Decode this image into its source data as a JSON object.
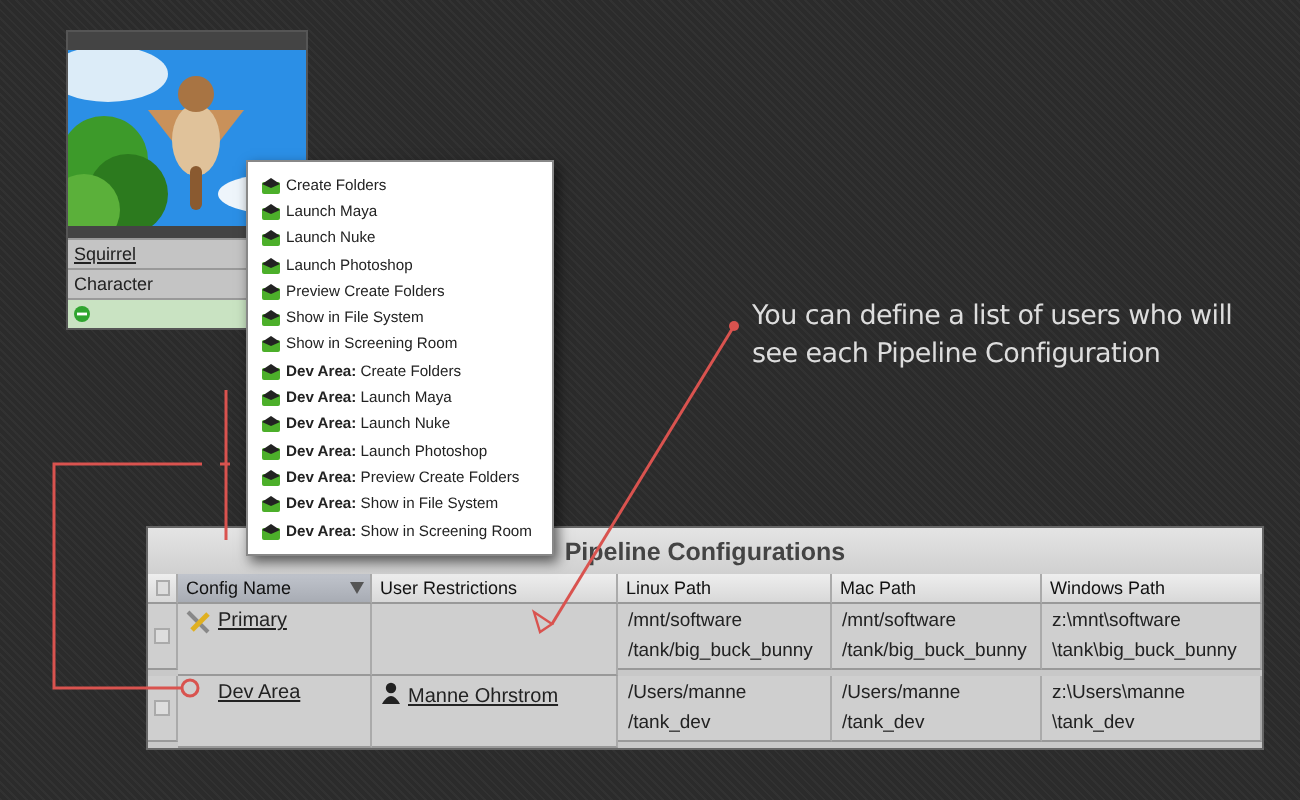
{
  "entity_card": {
    "kind": "picture",
    "name": "Squirrel",
    "type": "Character"
  },
  "context_menu": {
    "items": [
      {
        "label": "Create Folders"
      },
      {
        "label": "Launch Maya"
      },
      {
        "label": "Launch Nuke"
      },
      {
        "label": "Launch Photoshop"
      },
      {
        "label": "Preview Create Folders"
      },
      {
        "label": "Show in File System"
      },
      {
        "label": "Show in Screening Room"
      },
      {
        "label": "**Dev Area:** Create Folders"
      },
      {
        "label": "**Dev Area:** Launch Maya"
      },
      {
        "label": "**Dev Area:** Launch Nuke"
      },
      {
        "label": "**Dev Area:** Launch Photoshop"
      },
      {
        "label": "**Dev Area:** Preview Create Folders"
      },
      {
        "label": "**Dev Area:** Show in File System"
      },
      {
        "label": "**Dev Area:** Show in Screening Room"
      }
    ]
  },
  "callout": {
    "text": "You can define a list of users who will see each Pipeline Configuration"
  },
  "pipeline_table": {
    "title": "Pipeline Configurations",
    "all_checked": false,
    "columns": [
      "Config Name",
      "User Restrictions",
      "Linux Path",
      "Mac Path",
      "Windows Path"
    ],
    "rows": [
      {
        "checked": false,
        "primary": true,
        "name": "Primary",
        "users": [],
        "linux": [
          "/mnt/software",
          "/tank/big_buck_bunny"
        ],
        "mac": [
          "/mnt/software",
          "/tank/big_buck_bunny"
        ],
        "windows": [
          "z:\\mnt\\software",
          "\\tank\\big_buck_bunny"
        ]
      },
      {
        "checked": false,
        "primary": false,
        "name": "Dev Area",
        "users": [
          "Manne Ohrstrom"
        ],
        "linux": [
          "/Users/manne",
          "/tank_dev"
        ],
        "mac": [
          "/Users/manne",
          "/tank_dev"
        ],
        "windows": [
          "z:\\Users\\manne",
          "\\tank_dev"
        ]
      }
    ]
  }
}
